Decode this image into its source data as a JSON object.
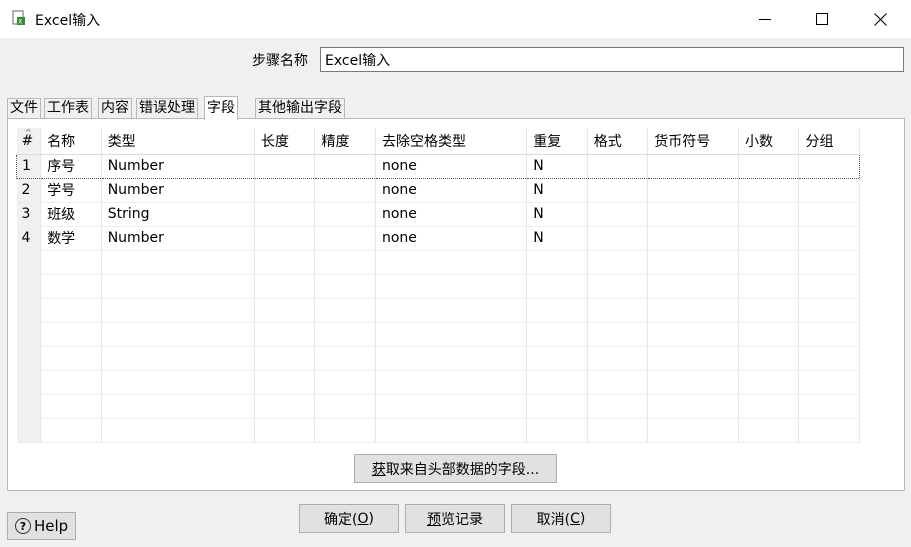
{
  "window": {
    "title": "Excel输入"
  },
  "step": {
    "label": "步骤名称",
    "value": "Excel输入"
  },
  "tabs": [
    {
      "label": "文件",
      "active": false
    },
    {
      "label": "工作表",
      "active": false
    },
    {
      "label": "内容",
      "active": false
    },
    {
      "label": "错误处理",
      "active": false
    },
    {
      "label": "字段",
      "active": true
    },
    {
      "label": "其他输出字段",
      "active": false
    }
  ],
  "grid": {
    "columns": [
      "#",
      "名称",
      "类型",
      "长度",
      "精度",
      "去除空格类型",
      "重复",
      "格式",
      "货币符号",
      "小数",
      "分组"
    ],
    "rows": [
      [
        "1",
        "序号",
        "Number",
        "",
        "",
        "none",
        "N",
        "",
        "",
        "",
        ""
      ],
      [
        "2",
        "学号",
        "Number",
        "",
        "",
        "none",
        "N",
        "",
        "",
        "",
        ""
      ],
      [
        "3",
        "班级",
        "String",
        "",
        "",
        "none",
        "N",
        "",
        "",
        "",
        ""
      ],
      [
        "4",
        "数学",
        "Number",
        "",
        "",
        "none",
        "N",
        "",
        "",
        "",
        ""
      ]
    ]
  },
  "buttons": {
    "get_fields": {
      "pre": "",
      "key": "获",
      "post": "取来自头部数据的字段..."
    },
    "ok": {
      "pre": "确定(",
      "key": "O",
      "post": ")"
    },
    "preview": {
      "pre": "",
      "key": "预",
      "post": "览记录"
    },
    "cancel": {
      "pre": "取消(",
      "key": "C",
      "post": ")"
    },
    "help": "Help"
  }
}
